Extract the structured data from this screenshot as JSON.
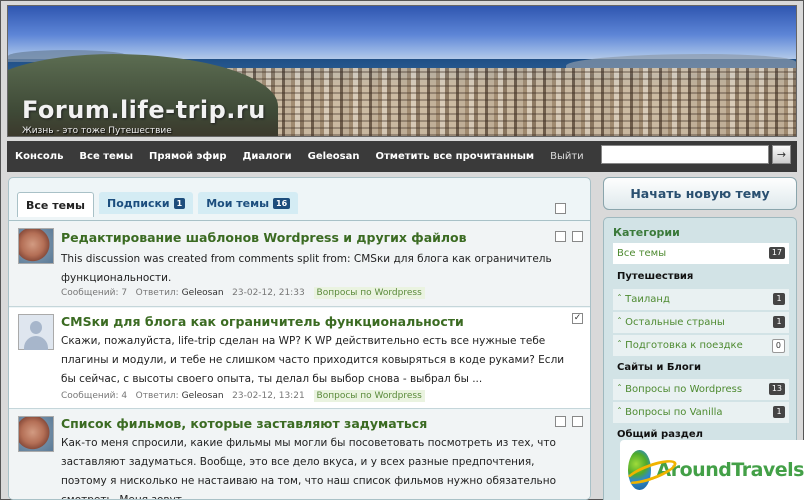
{
  "site": {
    "logo": "Forum.life-trip.ru",
    "tagline": "Жизнь - это тоже Путешествие"
  },
  "nav": {
    "items": [
      "Консоль",
      "Все темы",
      "Прямой эфир",
      "Диалоги",
      "Geleosan",
      "Отметить все прочитанным"
    ],
    "signout": "Выйти",
    "search_placeholder": "",
    "search_button": "→"
  },
  "tabs": [
    {
      "label": "Все темы",
      "active": true
    },
    {
      "label": "Подписки",
      "count": "1"
    },
    {
      "label": "Мои темы",
      "count": "16"
    }
  ],
  "discussions": [
    {
      "title": "Редактирование шаблонов Wordpress и других файлов",
      "body": "This discussion was created from comments split from: CMSки для блога как ограничитель функциональности.",
      "replies_label": "Сообщений: 7",
      "views_label": "Ответил:",
      "author": "Geleosan",
      "date": "23-02-12, 21:33",
      "category": "Вопросы по Wordpress",
      "checked": false
    },
    {
      "title": "CMSки для блога как ограничитель функциональности",
      "body": "Скажи, пожалуйста, life-trip сделан на WP? К WP действительно есть все нужные тебе плагины и модули, и тебе не слишком часто приходится ковыряться в коде руками? Если бы сейчас, с высоты своего опыта, ты делал бы выбор снова - выбрал бы ...",
      "replies_label": "Сообщений: 4",
      "views_label": "Ответил:",
      "author": "Geleosan",
      "date": "23-02-12, 13:21",
      "category": "Вопросы по Wordpress",
      "checked": true
    },
    {
      "title": "Список фильмов, которые заставляют задуматься",
      "body": "Как-то меня спросили, какие фильмы мы могли бы посоветовать посмотреть из тех, что заставляют задуматься. Вообще, это все дело вкуса, и у всех разные предпочтения, поэтому я нисколько не настаиваю на том, что наш список фильмов нужно обязательно смотреть. Меня зовут",
      "checked": false
    }
  ],
  "sidebar": {
    "new_topic": "Начать новую тему",
    "categories_title": "Категории",
    "rows": [
      {
        "label": "Все темы",
        "count": "17",
        "kind": "sel"
      },
      {
        "label": "Путешествия",
        "kind": "grp"
      },
      {
        "label": "ˆ Таиланд",
        "count": "1",
        "kind": "link"
      },
      {
        "label": "ˆ Остальные страны",
        "count": "1",
        "kind": "link"
      },
      {
        "label": "ˆ Подготовка к поездке",
        "count": "0",
        "kind": "link"
      },
      {
        "label": "Сайты и Блоги",
        "kind": "grp"
      },
      {
        "label": "ˆ Вопросы по Wordpress",
        "count": "13",
        "kind": "link"
      },
      {
        "label": "ˆ Вопросы по Vanilla",
        "count": "1",
        "kind": "link"
      },
      {
        "label": "Общий раздел",
        "kind": "grp"
      }
    ]
  },
  "watermark": {
    "text": "AroundTravels"
  }
}
